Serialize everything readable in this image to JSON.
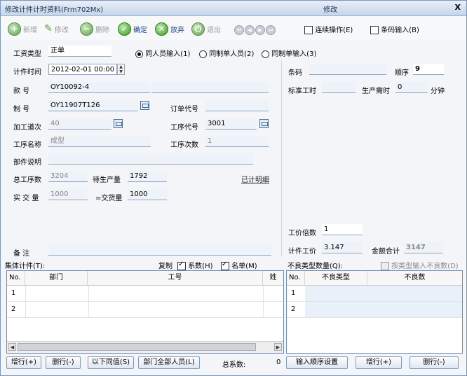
{
  "window": {
    "title_left": "修改计件计时资料(Frm702Mx)",
    "title_center": "修改",
    "close": "X"
  },
  "toolbar": {
    "add": "新增",
    "edit": "修改",
    "delete": "删除",
    "confirm": "确定",
    "abandon": "放弃",
    "exit": "退出",
    "continuous": "连续操作(E)",
    "barcode_input": "条码输入(B)"
  },
  "form": {
    "wage_type_label": "工资类型",
    "wage_type_value": "正单",
    "radio1": "同人员输入(1)",
    "radio2": "同制单人员(2)",
    "radio3": "同制单输入(3)",
    "time_label": "计件时间",
    "time_value": "2012-02-01 00:00",
    "style_label": "款  号",
    "style_value": "OY10092-4",
    "order_label": "制  号",
    "order_value": "OY11907T126",
    "order_no_label": "订单代号",
    "route_label": "加工道次",
    "route_value": "40",
    "proc_code_label": "工序代号",
    "proc_code_value": "3001",
    "proc_name_label": "工序名称",
    "proc_name_value": "成型",
    "proc_times_label": "工序次数",
    "proc_times_value": "1",
    "part_label": "部件说明",
    "total_proc_label": "总工序数",
    "total_proc_value": "3204",
    "pending_label": "待生产量",
    "pending_value": "1792",
    "detail_link": "已计明细",
    "actual_label": "实 交 量",
    "actual_value": "1000",
    "delivered_label": "=交货量",
    "delivered_value": "1000",
    "remark_label": "备   注",
    "barcode_label": "条码",
    "seq_label": "顺序",
    "seq_value": "9",
    "std_time_label": "标准工时",
    "prod_time_label": "生产需时",
    "prod_time_value": "0",
    "minute": "分钟",
    "price_multi_label": "工价倍数",
    "price_multi_value": "1",
    "unit_price_label": "计件工价",
    "unit_price_value": "3.147",
    "amount_label": "金额合计",
    "amount_value": "3147"
  },
  "group": {
    "label": "集体计件(T):",
    "copy": "复制",
    "coef": "系数(H)",
    "roster": "名单(M)",
    "col_no": "No.",
    "col_dept": "部门",
    "col_id": "工号",
    "col_x": "姓",
    "rows": [
      "1",
      "2"
    ]
  },
  "defect": {
    "label": "不良类型数量(Q):",
    "by_type": "按类型输入不良数(D)",
    "col_no": "No.",
    "col_type": "不良类型",
    "col_qty": "不良数",
    "rows": [
      "1",
      "2"
    ]
  },
  "buttons": {
    "add_row": "增行(+)",
    "del_row": "删行(-)",
    "fill_same": "以下同值(S)",
    "all_dept": "部门全部人员(L)",
    "total_coef_label": "总系数:",
    "total_coef_value": "0",
    "seq_setting": "输入顺序设置",
    "add_row2": "增行(+)",
    "del_row2": "删行(-)"
  }
}
